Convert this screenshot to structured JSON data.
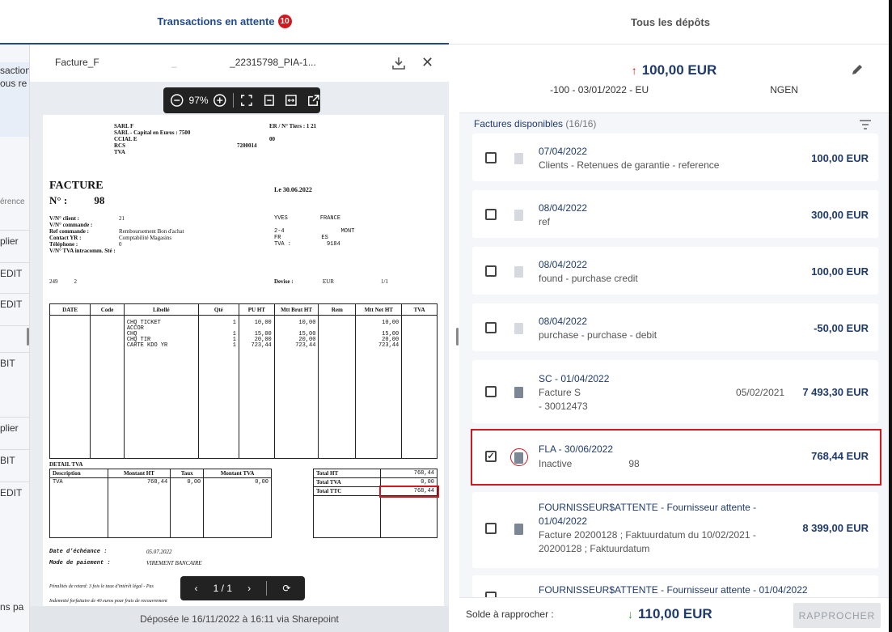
{
  "tabs": {
    "pending_label": "Transactions en attente",
    "pending_count": "10",
    "deposits_label": "Tous les dépôts"
  },
  "left_panel": {
    "items": [
      "saction",
      "ous re",
      "érence",
      "plier",
      "EDIT",
      "EDIT",
      "BIT",
      "plier",
      "BIT",
      "EDIT",
      "ns pa"
    ]
  },
  "viewer": {
    "title_left": "Facture_F",
    "title_mid": "_",
    "title_right": "_22315798_PIA-1...",
    "zoom": "97%",
    "page_indicator": "1 / 1",
    "footer": "Déposée le 16/11/2022 à 16:11 via Sharepoint"
  },
  "invoice": {
    "header_line1": "SARL F",
    "header_line2": "SARL - Capital en Euros : 7500",
    "header_line3": "CCIAL E",
    "header_line4": "RCS",
    "header_line5": "TVA",
    "header_right1": "ER / N° Tiers : 1",
    "header_right2": "21",
    "header_right3": "00",
    "header_right4": "7200014",
    "title": "FACTURE",
    "number_label": "N° :",
    "number_value": "98",
    "date": "Le 30.06.2022",
    "client_label": "V/N° client :",
    "client_value": "21",
    "commande_label": "V/N° commande :",
    "ref_label": "Ref commande :",
    "ref_value": "Remboursement Bon d'achat",
    "contact_label": "Contact YR :",
    "contact_value": "Comptabilité Magasins",
    "tel_label": "Téléphone :",
    "tel_value": "0",
    "tva_label": "V/N° TVA intracomm. Sté :",
    "addr1": "YVES",
    "addr1b": "FRANCE",
    "addr2": "2-4",
    "addr2b": "MONT",
    "addr3": "FR",
    "addr3b": "ES",
    "addr4": "TVA :",
    "addr4b": "9184",
    "left_code": "249",
    "left_code_b": "2",
    "devise_label": "Devise :",
    "devise_value": "EUR",
    "page_num": "1/1",
    "columns": [
      "DATE",
      "Code",
      "Libellé",
      "Qté",
      "PU HT",
      "Mtt Brut HT",
      "Rem",
      "Mtt Net HT",
      "TVA"
    ],
    "lines": [
      {
        "lib": "CHQ TICKET",
        "qte": "1",
        "pu": "10,00",
        "brut": "10,00",
        "net": "10,00"
      },
      {
        "lib": "ACCOR",
        "qte": "",
        "pu": "",
        "brut": "",
        "net": ""
      },
      {
        "lib": "CHQ",
        "qte": "1",
        "pu": "15,00",
        "brut": "15,00",
        "net": "15,00"
      },
      {
        "lib": "CHQ TIR",
        "qte": "1",
        "pu": "20,00",
        "brut": "20,00",
        "net": "20,00"
      },
      {
        "lib": "CARTE KDO YR",
        "qte": "1",
        "pu": "723,44",
        "brut": "723,44",
        "net": "723,44"
      }
    ],
    "detail_tva": "DETAIL TVA",
    "tva_cols": [
      "Description",
      "Montant HT",
      "Taux",
      "Montant TVA"
    ],
    "tva_row": {
      "desc": "TVA",
      "ht": "768,44",
      "taux": "0,00",
      "mt": "0,00"
    },
    "totals": [
      {
        "label": "Total HT",
        "value": "768,44"
      },
      {
        "label": "Total TVA",
        "value": "0,00"
      },
      {
        "label": "Total TTC",
        "value": "768,44"
      }
    ],
    "echeance_label": "Date d'échéance :",
    "echeance_value": "05.07.2022",
    "paiement_label": "Mode de paiement :",
    "paiement_value": "VIREMENT BANCAIRE",
    "penalites": "Pénalités de retard: 3 fois le taux d'intérêt légal - Pas",
    "indemnite": "Indemnité forfaitaire de 40 euros pour frais de recouvrement"
  },
  "transaction": {
    "amount": "100,00 EUR",
    "subtitle": "-100 - 03/01/2022 - EU",
    "subtitle_end": "NGEN"
  },
  "factures": {
    "label": "Factures disponibles",
    "count": "(16/16)",
    "items": [
      {
        "title": "07/04/2022",
        "sub": "Clients - Retenues de garantie - reference",
        "amount": "100,00 EUR"
      },
      {
        "title": "08/04/2022",
        "sub": "ref",
        "amount": "300,00 EUR"
      },
      {
        "title": "08/04/2022",
        "sub": "found - purchase credit",
        "amount": "100,00 EUR"
      },
      {
        "title": "08/04/2022",
        "sub": "purchase - purchase - debit",
        "amount": "-50,00 EUR"
      },
      {
        "title": "SC - 01/04/2022",
        "sub": "Facture S",
        "sub2": "- 30012473",
        "sub_right": "05/02/2021",
        "amount": "7 493,30 EUR"
      },
      {
        "title": "FLA - 30/06/2022",
        "sub": "Inactive",
        "sub_right": "98",
        "amount": "768,44 EUR"
      },
      {
        "title": "FOURNISSEUR$ATTENTE - Fournisseur attente -",
        "title2": "01/04/2022",
        "sub": "Facture 20200128 ; Faktuurdatum du 10/02/2021 -",
        "sub2": "20200128 ; Faktuurdatum",
        "amount": "8 399,00 EUR"
      },
      {
        "title": "FOURNISSEUR$ATTENTE - Fournisseur attente - 01/04/2022"
      }
    ]
  },
  "footer": {
    "solde_label": "Solde à rapprocher :",
    "solde_amount": "110,00 EUR",
    "button": "RAPPROCHER"
  },
  "colors": {
    "accent": "#1f4a8f",
    "badge": "#d0191f",
    "highlight": "#d0191f",
    "up": "#d0191f",
    "down": "#3a9a3a"
  }
}
